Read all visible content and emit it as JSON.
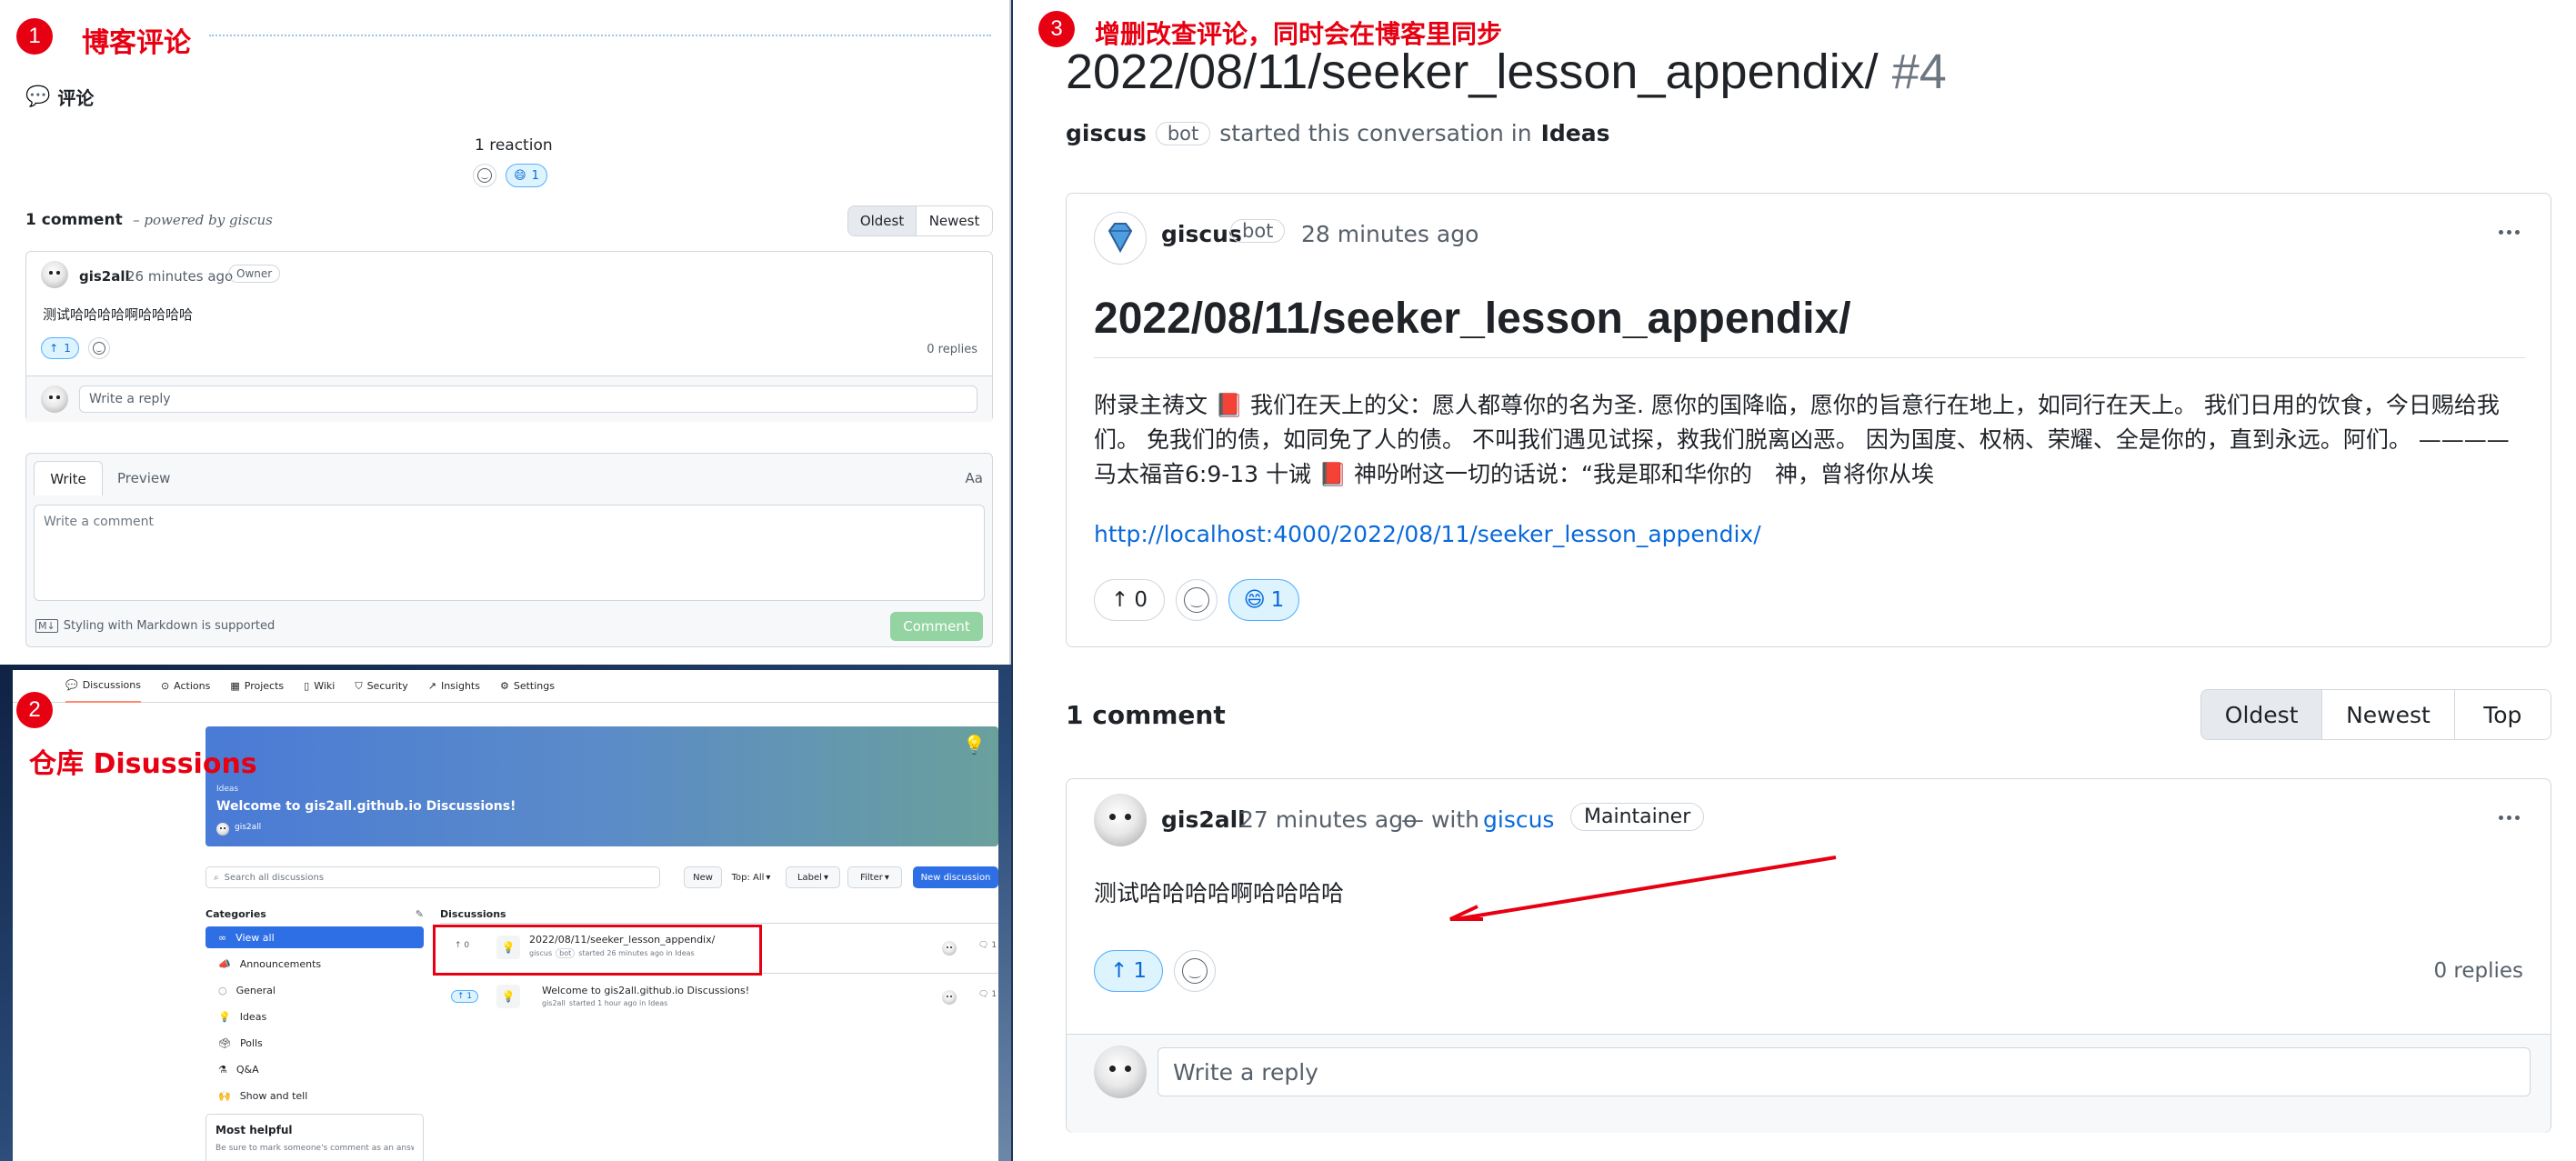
{
  "panel1": {
    "badge": "1",
    "title": "博客评论",
    "section_title": "评论",
    "reactions_count": "1 reaction",
    "reaction_count": "1",
    "comments_count": "1 comment",
    "powered_by": "– powered by giscus",
    "sort_oldest": "Oldest",
    "sort_newest": "Newest",
    "comment": {
      "author": "gis2all",
      "time": "26 minutes ago",
      "role": "Owner",
      "body": "测试哈哈哈哈啊哈哈哈哈",
      "upvotes": "1",
      "replies": "0 replies"
    },
    "reply_placeholder": "Write a reply",
    "editor": {
      "tab_write": "Write",
      "tab_preview": "Preview",
      "aa": "Aa",
      "placeholder": "Write a comment",
      "markdown_hint": "Styling with Markdown is supported",
      "submit": "Comment"
    }
  },
  "panel2": {
    "badge": "2",
    "title": "仓库 Disussions",
    "nav": [
      "Discussions",
      "Actions",
      "Projects",
      "Wiki",
      "Security",
      "Insights",
      "Settings"
    ],
    "banner": {
      "category": "Ideas",
      "title": "Welcome to gis2all.github.io Discussions!",
      "author": "gis2all"
    },
    "search_placeholder": "Search all discussions",
    "buttons": {
      "new": "New",
      "top": "Top: All",
      "label": "Label",
      "filter": "Filter",
      "new_discussion": "New discussion"
    },
    "categories_title": "Categories",
    "categories": [
      {
        "icon": "infinity-icon",
        "label": "View all"
      },
      {
        "icon": "megaphone-icon",
        "label": "Announcements"
      },
      {
        "icon": "bubble-icon",
        "label": "General"
      },
      {
        "icon": "bulb-icon",
        "label": "Ideas"
      },
      {
        "icon": "ballot-icon",
        "label": "Polls"
      },
      {
        "icon": "flask-icon",
        "label": "Q&A"
      },
      {
        "icon": "hands-icon",
        "label": "Show and tell"
      }
    ],
    "most_helpful": "Most helpful",
    "most_helpful_sub": "Be sure to mark someone's comment as an answer if it",
    "discussions_title": "Discussions",
    "discussions": [
      {
        "votes": "0",
        "title": "2022/08/11/seeker_lesson_appendix/",
        "author": "giscus",
        "badge": "bot",
        "meta": "started 26 minutes ago in Ideas",
        "comments": "1"
      },
      {
        "votes": "1",
        "title": "Welcome to gis2all.github.io Discussions!",
        "author": "gis2all",
        "badge": "",
        "meta": "started 1 hour ago in Ideas",
        "comments": "1"
      }
    ]
  },
  "panel3": {
    "badge": "3",
    "title": "增删改查评论，同时会在博客里同步",
    "discussion_title": "2022/08/11/seeker_lesson_appendix/",
    "discussion_number": "#4",
    "starter": "giscus",
    "bot_badge": "bot",
    "started_text": "started this conversation in",
    "category": "Ideas",
    "post": {
      "author": "giscus",
      "badge": "bot",
      "time": "28 minutes ago",
      "heading": "2022/08/11/seeker_lesson_appendix/",
      "body": "附录主祷文 📕 我们在天上的父：愿人都尊你的名为圣. 愿你的国降临，愿你的旨意行在地上，如同行在天上。 我们日用的饮食，今日赐给我们。 免我们的债，如同免了人的债。 不叫我们遇见试探，救我们脱离凶恶。 因为国度、权柄、荣耀、全是你的，直到永远。阿们。 ————马太福音6:9-13 十诫 📕 神吩咐这一切的话说：“我是耶和华你的　神，曾将你从埃",
      "link": "http://localhost:4000/2022/08/11/seeker_lesson_appendix/",
      "upvotes": "0",
      "reaction_count": "1"
    },
    "comments_count": "1 comment",
    "sort_oldest": "Oldest",
    "sort_newest": "Newest",
    "sort_top": "Top",
    "comment": {
      "author": "gis2all",
      "time": "27 minutes ago",
      "with": "— with",
      "app": "giscus",
      "role": "Maintainer",
      "body": "测试哈哈哈哈啊哈哈哈哈",
      "upvotes": "1",
      "replies": "0 replies"
    },
    "reply_placeholder": "Write a reply"
  },
  "colors": {
    "annotation_red": "#e60012",
    "link_blue": "#0969da",
    "github_green": "#2da44e"
  }
}
